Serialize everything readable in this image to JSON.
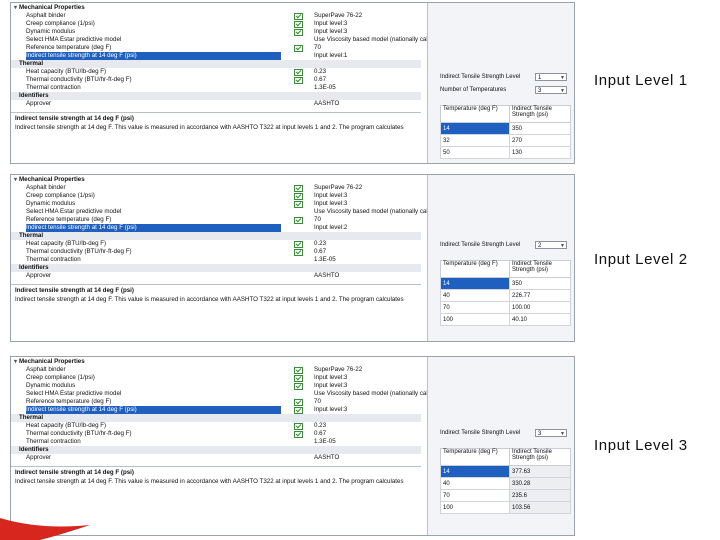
{
  "captions": [
    "Input Level 1",
    "Input Level 2",
    "Input Level 3"
  ],
  "panels": [
    {
      "header": "Mechanical Properties",
      "rows": [
        {
          "label": "Asphalt binder",
          "check": true,
          "value": "SuperPave 76-22"
        },
        {
          "label": "Creep compliance (1/psi)",
          "check": true,
          "value": "Input level:3"
        },
        {
          "label": "Dynamic modulus",
          "check": true,
          "value": "Input level:3"
        },
        {
          "label": "Select HMA Estar predictive model",
          "check": false,
          "value": "Use Viscosity based model (nationally calibrated)."
        },
        {
          "label": "Reference temperature (deg F)",
          "check": true,
          "value": "70"
        },
        {
          "label": "Indirect tensile strength at 14 deg F (psi)",
          "check": false,
          "value": "Input level:1",
          "selected": true
        }
      ],
      "thermal_header": "Thermal",
      "thermal_rows": [
        {
          "label": "Heat capacity (BTU/lb-deg F)",
          "check": true,
          "value": "0.23"
        },
        {
          "label": "Thermal conductivity (BTU/hr-ft-deg F)",
          "check": true,
          "value": "0.67"
        },
        {
          "label": "Thermal contraction",
          "check": false,
          "value": "1.3E-05"
        }
      ],
      "identifiers_header": "Identifiers",
      "identifier_rows": [
        {
          "label": "Approver",
          "value": "AASHTO"
        }
      ],
      "desc_title": "Indirect tensile strength at 14 deg F (psi)",
      "desc_text": "Indirect tensile strength at 14 deg F. This value is measured in accordance with AASHTO T322 at input levels 1 and 2. The program calculates",
      "fields": [
        {
          "label": "Indirect Tensile Strength Level",
          "value": "1"
        },
        {
          "label": "Number of Temperatures",
          "value": "3"
        }
      ],
      "table": {
        "headers": [
          "Temperature (deg F)",
          "Indirect Tensile Strength (psi)"
        ],
        "rows": [
          [
            "14",
            "350"
          ],
          [
            "32",
            "270"
          ],
          [
            "50",
            "130"
          ]
        ]
      }
    },
    {
      "header": "Mechanical Properties",
      "rows": [
        {
          "label": "Asphalt binder",
          "check": true,
          "value": "SuperPave 76-22"
        },
        {
          "label": "Creep compliance (1/psi)",
          "check": true,
          "value": "Input level:3"
        },
        {
          "label": "Dynamic modulus",
          "check": true,
          "value": "Input level:3"
        },
        {
          "label": "Select HMA Estar predictive model",
          "check": false,
          "value": "Use Viscosity based model (nationally calibrated)."
        },
        {
          "label": "Reference temperature (deg F)",
          "check": true,
          "value": "70"
        },
        {
          "label": "Indirect tensile strength at 14 deg F (psi)",
          "check": false,
          "value": "Input level:2",
          "selected": true
        }
      ],
      "thermal_header": "Thermal",
      "thermal_rows": [
        {
          "label": "Heat capacity (BTU/lb-deg F)",
          "check": true,
          "value": "0.23"
        },
        {
          "label": "Thermal conductivity (BTU/hr-ft-deg F)",
          "check": true,
          "value": "0.67"
        },
        {
          "label": "Thermal contraction",
          "check": false,
          "value": "1.3E-05"
        }
      ],
      "identifiers_header": "Identifiers",
      "identifier_rows": [
        {
          "label": "Approver",
          "value": "AASHTO"
        }
      ],
      "desc_title": "Indirect tensile strength at 14 deg F (psi)",
      "desc_text": "Indirect tensile strength at 14 deg F. This value is measured in accordance with AASHTO T322 at input levels 1 and 2. The program calculates",
      "fields": [
        {
          "label": "Indirect Tensile Strength Level",
          "value": "2"
        }
      ],
      "table": {
        "headers": [
          "Temperature (deg F)",
          "Indirect Tensile Strength (psi)"
        ],
        "rows": [
          [
            "14",
            "350"
          ],
          [
            "40",
            "226.77"
          ],
          [
            "70",
            "100.00"
          ],
          [
            "100",
            "40.10"
          ]
        ]
      }
    },
    {
      "header": "Mechanical Properties",
      "rows": [
        {
          "label": "Asphalt binder",
          "check": true,
          "value": "SuperPave 76-22"
        },
        {
          "label": "Creep compliance (1/psi)",
          "check": true,
          "value": "Input level:3"
        },
        {
          "label": "Dynamic modulus",
          "check": true,
          "value": "Input level:3"
        },
        {
          "label": "Select HMA Estar predictive model",
          "check": false,
          "value": "Use Viscosity based model (nationally calibrated)."
        },
        {
          "label": "Reference temperature (deg F)",
          "check": true,
          "value": "70"
        },
        {
          "label": "Indirect tensile strength at 14 deg F (psi)",
          "check": true,
          "value": "Input level:3",
          "selected": true
        }
      ],
      "thermal_header": "Thermal",
      "thermal_rows": [
        {
          "label": "Heat capacity (BTU/lb-deg F)",
          "check": true,
          "value": "0.23"
        },
        {
          "label": "Thermal conductivity (BTU/hr-ft-deg F)",
          "check": true,
          "value": "0.67"
        },
        {
          "label": "Thermal contraction",
          "check": false,
          "value": "1.3E-05"
        }
      ],
      "identifiers_header": "Identifiers",
      "identifier_rows": [
        {
          "label": "Approver",
          "value": "AASHTO"
        }
      ],
      "desc_title": "Indirect tensile strength at 14 deg F (psi)",
      "desc_text": "Indirect tensile strength at 14 deg F. This value is measured in accordance with AASHTO T322 at input levels 1 and 2. The program calculates",
      "fields": [
        {
          "label": "Indirect Tensile Strength Level",
          "value": "3"
        }
      ],
      "table": {
        "headers": [
          "Temperature (deg F)",
          "Indirect Tensile Strength (psi)"
        ],
        "rows": [
          [
            "14",
            "377.63"
          ],
          [
            "40",
            "330.28"
          ],
          [
            "70",
            "235.6"
          ],
          [
            "100",
            "103.56"
          ]
        ]
      }
    }
  ],
  "colors": {
    "selection": "#1f5fbf",
    "check": "#2e8b2e",
    "accent_red": "#d7261e"
  }
}
